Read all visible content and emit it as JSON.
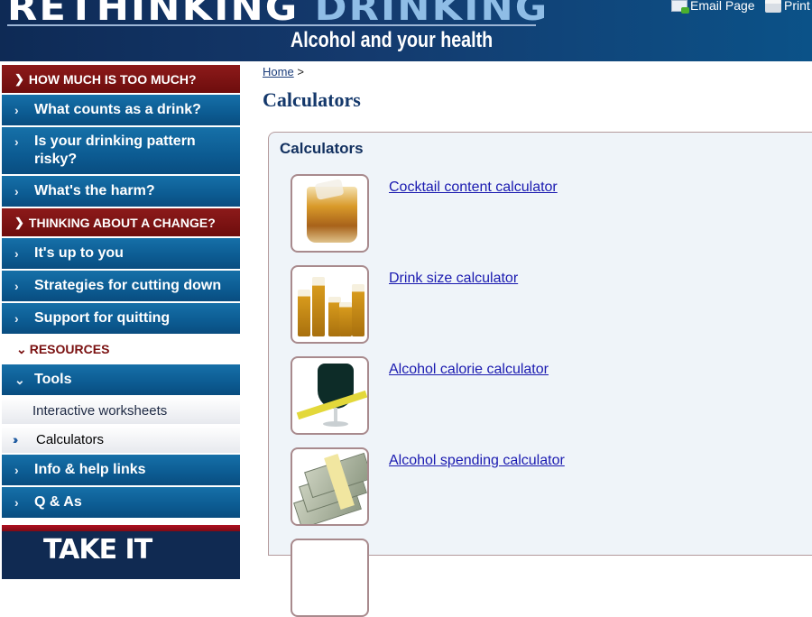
{
  "header": {
    "title_part1": "RETHINKING",
    "title_part2": "DRINKING",
    "subtitle": "Alcohol and your health",
    "email_label": "Email Page",
    "print_label": "Print"
  },
  "sidebar": {
    "section1": "HOW MUCH IS TOO MUCH?",
    "section1_items": [
      "What counts as a drink?",
      "Is your drinking pattern risky?",
      "What's the harm?"
    ],
    "section2": "THINKING ABOUT A CHANGE?",
    "section2_items": [
      "It's up to you",
      "Strategies for cutting down",
      "Support for quitting"
    ],
    "resources": "RESOURCES",
    "tools": "Tools",
    "tools_sub": [
      "Interactive worksheets",
      "Calculators"
    ],
    "more_items": [
      "Info & help links",
      "Q & As"
    ],
    "promo_text": "TAKE IT"
  },
  "breadcrumb": {
    "home": "Home",
    "separator": ">"
  },
  "main": {
    "page_title": "Calculators",
    "panel_title": "Calculators",
    "calculators": [
      {
        "label": "Cocktail content calculator",
        "icon": "cocktail-glass-image"
      },
      {
        "label": "Drink size calculator",
        "icon": "beer-glasses-image"
      },
      {
        "label": "Alcohol calorie calculator",
        "icon": "beer-measuring-tape-image"
      },
      {
        "label": "Alcohol spending calculator",
        "icon": "cash-stack-image"
      }
    ]
  },
  "colors": {
    "header_bg": "#143a6e",
    "section_red": "#7d1212",
    "nav_blue": "#0c5b92",
    "link": "#1a1ab0",
    "title_navy": "#14386b"
  }
}
